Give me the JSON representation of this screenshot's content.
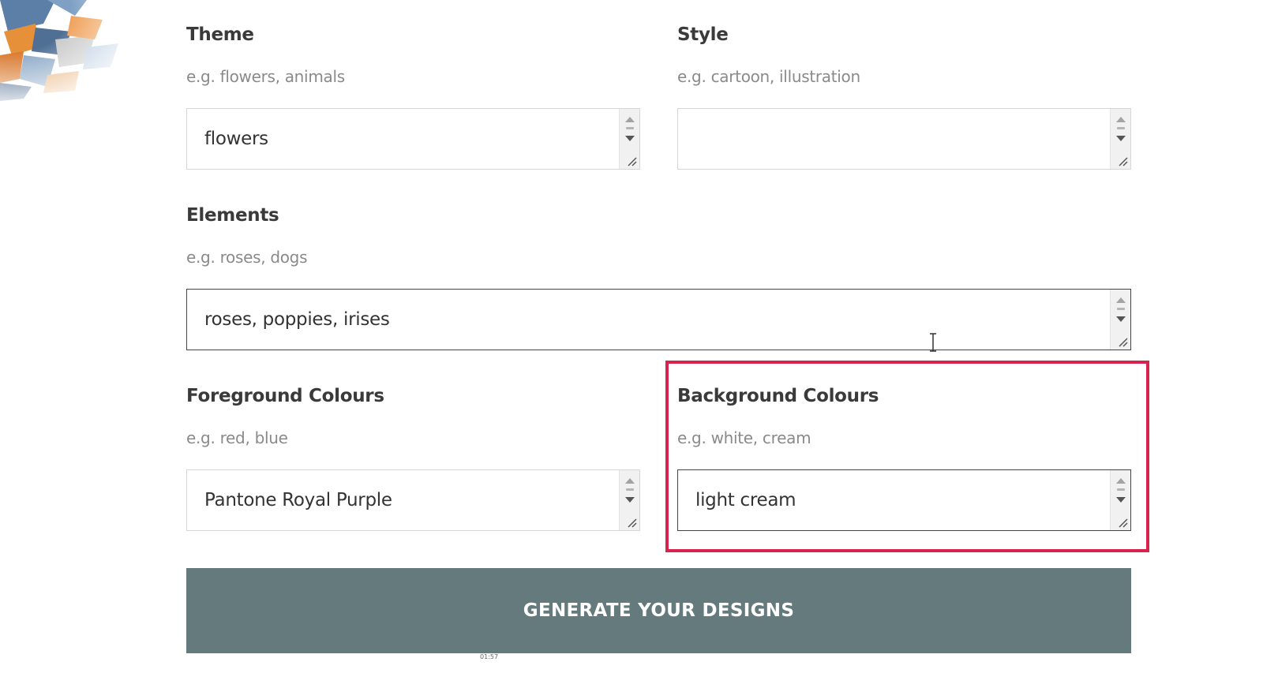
{
  "form": {
    "theme": {
      "label": "Theme",
      "hint": "e.g. flowers, animals",
      "value": "flowers"
    },
    "style": {
      "label": "Style",
      "hint": "e.g. cartoon, illustration",
      "value": ""
    },
    "elements": {
      "label": "Elements",
      "hint": "e.g. roses, dogs",
      "value": "roses, poppies, irises"
    },
    "foreground": {
      "label": "Foreground Colours",
      "hint": "e.g. red, blue",
      "value": "Pantone Royal Purple"
    },
    "background": {
      "label": "Background Colours",
      "hint": "e.g. white, cream",
      "value": "light cream"
    }
  },
  "submit": {
    "label": "GENERATE YOUR DESIGNS"
  },
  "video": {
    "timestamp": "01:57"
  },
  "colors": {
    "button_bg": "#647a7c",
    "highlight": "#d8234f"
  }
}
